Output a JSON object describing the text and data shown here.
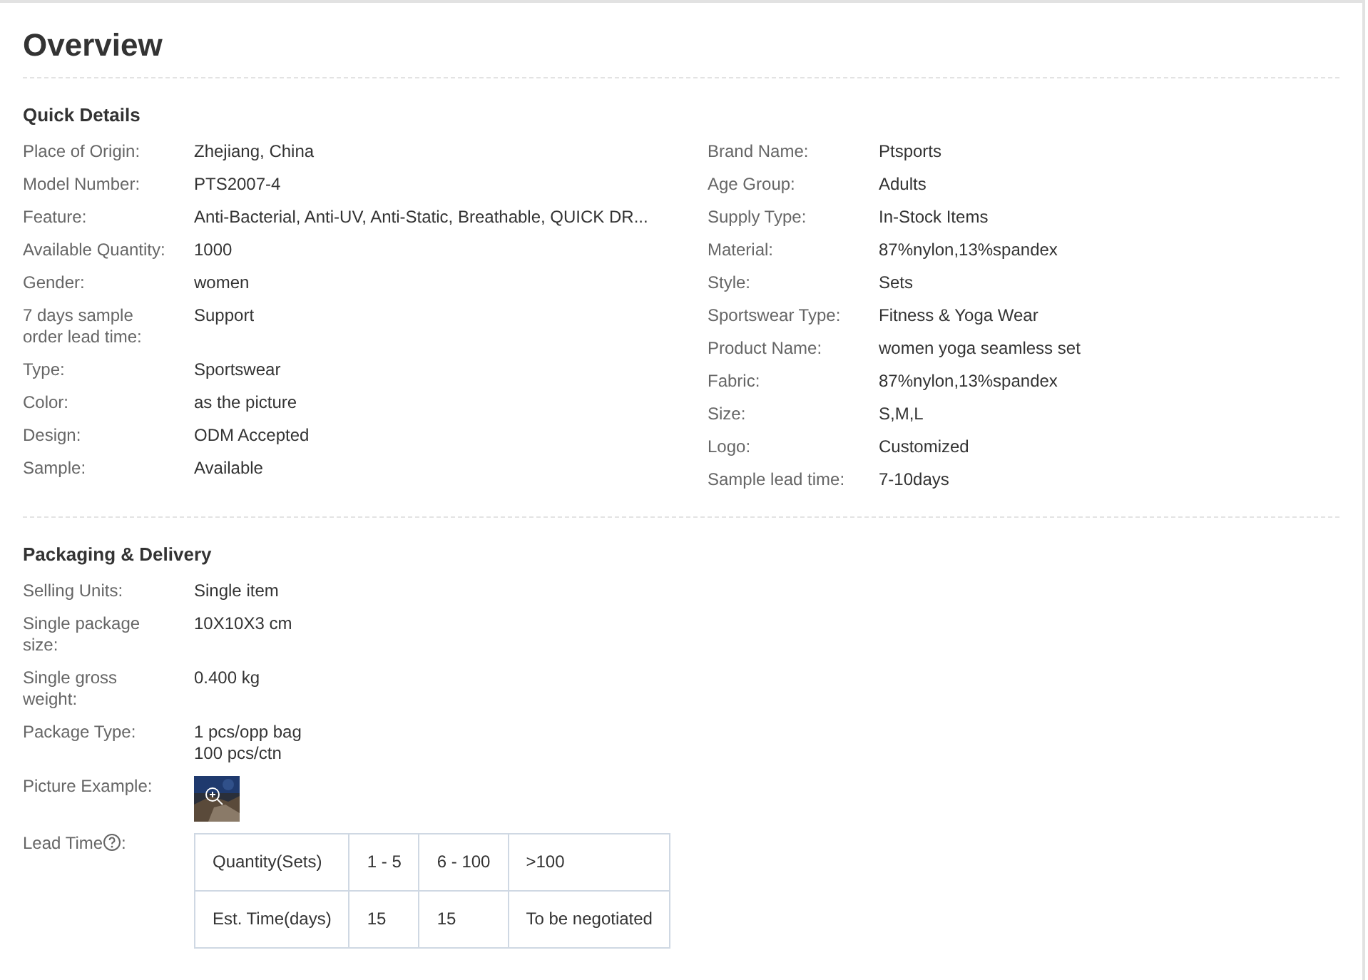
{
  "title": "Overview",
  "quick_details": {
    "heading": "Quick Details",
    "left": [
      {
        "label": "Place of Origin:",
        "value": "Zhejiang, China"
      },
      {
        "label": "Model Number:",
        "value": "PTS2007-4"
      },
      {
        "label": "Feature:",
        "value": "Anti-Bacterial, Anti-UV, Anti-Static, Breathable, QUICK DR..."
      },
      {
        "label": "Available Quantity:",
        "value": "1000"
      },
      {
        "label": "Gender:",
        "value": "women"
      },
      {
        "label": "7 days sample order lead time:",
        "value": "Support"
      },
      {
        "label": "Type:",
        "value": "Sportswear"
      },
      {
        "label": "Color:",
        "value": "as the picture"
      },
      {
        "label": "Design:",
        "value": "ODM Accepted"
      },
      {
        "label": "Sample:",
        "value": "Available"
      }
    ],
    "right": [
      {
        "label": "Brand Name:",
        "value": "Ptsports"
      },
      {
        "label": "Age Group:",
        "value": "Adults"
      },
      {
        "label": "Supply Type:",
        "value": "In-Stock Items"
      },
      {
        "label": "Material:",
        "value": "87%nylon,13%spandex"
      },
      {
        "label": "Style:",
        "value": "Sets"
      },
      {
        "label": "Sportswear Type:",
        "value": "Fitness & Yoga Wear"
      },
      {
        "label": "Product Name:",
        "value": "women yoga seamless set"
      },
      {
        "label": "Fabric:",
        "value": "87%nylon,13%spandex"
      },
      {
        "label": "Size:",
        "value": "S,M,L"
      },
      {
        "label": "Logo:",
        "value": "Customized"
      },
      {
        "label": "Sample lead time:",
        "value": "7-10days"
      }
    ]
  },
  "packaging": {
    "heading": "Packaging & Delivery",
    "rows": [
      {
        "kind": "text",
        "label": "Selling Units:",
        "lines": [
          "Single item"
        ]
      },
      {
        "kind": "text",
        "label": "Single package size:",
        "lines": [
          "10X10X3 cm"
        ]
      },
      {
        "kind": "text",
        "label": "Single gross weight:",
        "lines": [
          "0.400 kg"
        ]
      },
      {
        "kind": "text",
        "label": "Package Type:",
        "lines": [
          "1 pcs/opp bag",
          "100 pcs/ctn"
        ]
      },
      {
        "kind": "picture",
        "label": "Picture Example:"
      },
      {
        "kind": "table",
        "label": "Lead Time",
        "label_end": ":",
        "table": {
          "rows": [
            [
              "Quantity(Sets)",
              "1 - 5",
              "6 - 100",
              ">100"
            ],
            [
              "Est. Time(days)",
              "15",
              "15",
              "To be negotiated"
            ]
          ]
        }
      }
    ]
  }
}
